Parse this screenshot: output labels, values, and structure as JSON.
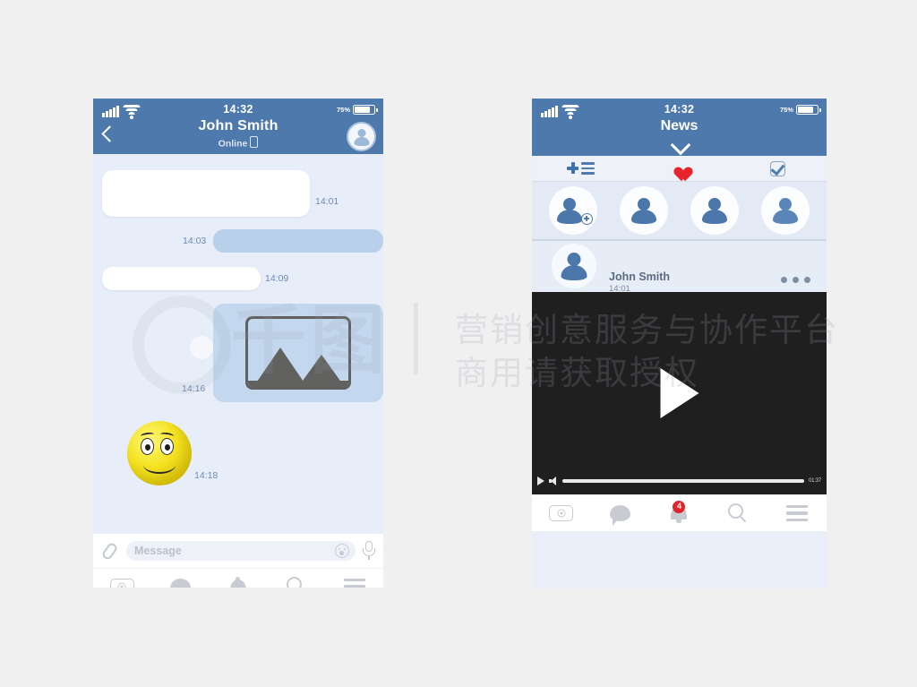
{
  "page": {
    "background_color": "#f0f0f0",
    "accent_blue": "#4e79ac",
    "bubble_out_color": "#b9d0ea",
    "badge_red": "#e1232c",
    "heart_red": "#e8232b"
  },
  "watermark": {
    "logo_icon": "circle-logo-watermark",
    "brand_cn": "千图",
    "line1_cn": "营销创意服务与协作平台",
    "line2_cn": "商用请获取授权"
  },
  "chat_phone": {
    "status": {
      "signal_icon": "signal-bars-icon",
      "wifi_icon": "wifi-icon",
      "time": "14:32",
      "battery_percent": "75%",
      "battery_icon": "battery-icon"
    },
    "header": {
      "back_icon": "back-chevron-icon",
      "contact_name": "John Smith",
      "status_text": "Online",
      "device_icon": "mobile-device-icon",
      "avatar_icon": "contact-avatar-icon"
    },
    "messages": [
      {
        "id": "m1",
        "direction": "incoming",
        "type": "text",
        "text": "",
        "time": "14:01"
      },
      {
        "id": "m2",
        "direction": "outgoing",
        "type": "text",
        "text": "",
        "time": "14:03"
      },
      {
        "id": "m3",
        "direction": "incoming",
        "type": "text",
        "text": "",
        "time": "14:09"
      },
      {
        "id": "m4",
        "direction": "outgoing",
        "type": "image",
        "image_icon": "image-placeholder-icon",
        "time": "14:16"
      },
      {
        "id": "m5",
        "direction": "incoming",
        "type": "sticker",
        "sticker_icon": "smiley-sticker-icon",
        "time": "14:18"
      }
    ],
    "input_bar": {
      "attach_icon": "paperclip-icon",
      "placeholder": "Message",
      "value": "",
      "emoji_icon": "emoji-smiley-icon",
      "mic_icon": "microphone-icon"
    },
    "bottom_nav": [
      {
        "name": "camera",
        "icon": "camera-icon",
        "badge": ""
      },
      {
        "name": "messages",
        "icon": "chat-bubble-icon",
        "badge": ""
      },
      {
        "name": "notifications",
        "icon": "bell-icon",
        "badge": ""
      },
      {
        "name": "search",
        "icon": "search-icon",
        "badge": ""
      },
      {
        "name": "menu",
        "icon": "hamburger-menu-icon",
        "badge": ""
      }
    ]
  },
  "news_phone": {
    "status": {
      "signal_icon": "signal-bars-icon",
      "wifi_icon": "wifi-icon",
      "time": "14:32",
      "battery_percent": "75%",
      "battery_icon": "battery-icon"
    },
    "header": {
      "title": "News",
      "dropdown_icon": "chevron-down-icon"
    },
    "action_bar": [
      {
        "name": "add-to-list",
        "icon": "plus-list-icon"
      },
      {
        "name": "favorites",
        "icon": "heart-icon"
      },
      {
        "name": "tasks",
        "icon": "checkbox-checked-icon"
      }
    ],
    "stories": [
      {
        "name": "add-story",
        "icon": "add-person-icon"
      },
      {
        "name": "story-1",
        "icon": "person-icon"
      },
      {
        "name": "story-2",
        "icon": "person-icon"
      },
      {
        "name": "story-3",
        "icon": "person-icon"
      }
    ],
    "post": {
      "avatar_icon": "person-avatar-icon",
      "author": "John Smith",
      "time": "14:01",
      "more_icon": "more-options-icon",
      "video": {
        "play_icon": "play-button-icon",
        "mini_play_icon": "mini-play-icon",
        "volume_icon": "volume-icon",
        "progress_percent": 100,
        "duration": "01:37"
      }
    },
    "bottom_nav": [
      {
        "name": "camera",
        "icon": "camera-icon",
        "badge": ""
      },
      {
        "name": "messages",
        "icon": "chat-bubble-icon",
        "badge": ""
      },
      {
        "name": "notifications",
        "icon": "bell-icon",
        "badge": "4"
      },
      {
        "name": "search",
        "icon": "search-icon",
        "badge": ""
      },
      {
        "name": "menu",
        "icon": "hamburger-menu-icon",
        "badge": ""
      }
    ]
  }
}
